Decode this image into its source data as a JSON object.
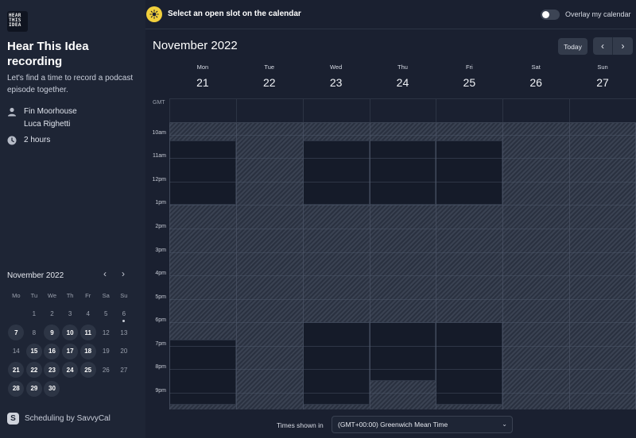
{
  "sidebar": {
    "logo_text": "HEAR THIS IDEA",
    "title": "Hear This Idea recording",
    "description": "Let's find a time to record a podcast episode together.",
    "hosts": [
      "Fin Moorhouse",
      "Luca Righetti"
    ],
    "duration": "2 hours",
    "host_icon": "person-icon",
    "duration_icon": "clock-icon",
    "mini_calendar": {
      "month": "November 2022",
      "weekdays": [
        "Mo",
        "Tu",
        "We",
        "Th",
        "Fr",
        "Sa",
        "Su"
      ],
      "leading_blanks": 1,
      "today": 6,
      "days": [
        1,
        2,
        3,
        4,
        5,
        6,
        7,
        8,
        9,
        10,
        11,
        12,
        13,
        14,
        15,
        16,
        17,
        18,
        19,
        20,
        21,
        22,
        23,
        24,
        25,
        26,
        27,
        28,
        29,
        30
      ],
      "available": [
        7,
        9,
        10,
        11,
        15,
        16,
        17,
        18,
        21,
        22,
        23,
        24,
        25,
        28,
        29,
        30
      ]
    },
    "branding": "Scheduling by SavvyCal",
    "branding_mark": "S"
  },
  "topbar": {
    "message": "Select an open slot on the calendar",
    "overlay_label": "Overlay my calendar",
    "overlay_on": false
  },
  "calendar": {
    "month_label": "November 2022",
    "today_label": "Today",
    "prev_icon": "chevron-left-icon",
    "next_icon": "chevron-right-icon",
    "gmt_label": "GMT",
    "days": [
      {
        "name": "Mon",
        "num": "21"
      },
      {
        "name": "Tue",
        "num": "22"
      },
      {
        "name": "Wed",
        "num": "23"
      },
      {
        "name": "Thu",
        "num": "24"
      },
      {
        "name": "Fri",
        "num": "25"
      },
      {
        "name": "Sat",
        "num": "26"
      },
      {
        "name": "Sun",
        "num": "27"
      }
    ],
    "hours": [
      "10am",
      "11am",
      "12pm",
      "1pm",
      "2pm",
      "3pm",
      "4pm",
      "5pm",
      "6pm",
      "7pm",
      "8pm",
      "9pm"
    ],
    "visible_start_hour": 9.5,
    "visible_end_hour": 21.75,
    "open_slots": [
      {
        "day": 0,
        "start": 10.25,
        "end": 13.0
      },
      {
        "day": 0,
        "start": 18.75,
        "end": 21.5
      },
      {
        "day": 2,
        "start": 10.25,
        "end": 13.0
      },
      {
        "day": 2,
        "start": 18.0,
        "end": 21.5
      },
      {
        "day": 3,
        "start": 10.25,
        "end": 13.0
      },
      {
        "day": 3,
        "start": 18.0,
        "end": 20.5
      },
      {
        "day": 4,
        "start": 10.25,
        "end": 13.0
      },
      {
        "day": 4,
        "start": 18.0,
        "end": 21.5
      }
    ]
  },
  "footer": {
    "prefix": "Times shown in",
    "timezone": "(GMT+00:00) Greenwich Mean Time"
  },
  "colors": {
    "accent": "#f1cf3c",
    "background": "#1a2030",
    "sidebar": "#1e2535",
    "open_slot": "#151b29"
  }
}
